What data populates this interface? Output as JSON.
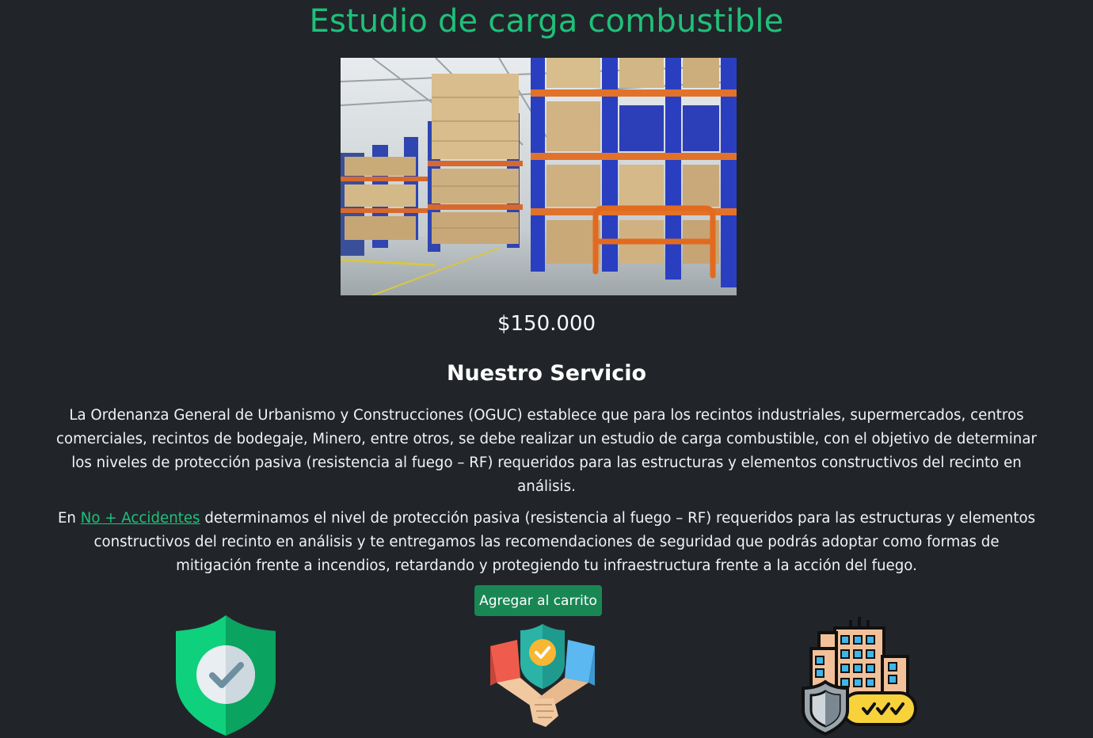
{
  "product": {
    "title": "Estudio de carga combustible",
    "price": "$150.000",
    "image_alt": "warehouse-photo"
  },
  "service": {
    "heading": "Nuestro Servicio",
    "paragraph1": "La Ordenanza General de Urbanismo y Construcciones (OGUC) establece que para los recintos industriales, supermercados, centros comerciales, recintos de bodegaje, Minero, entre otros, se debe realizar un estudio de carga combustible, con el objetivo de determinar los niveles de protección pasiva (resistencia al fuego – RF) requeridos para las estructuras y elementos constructivos del recinto en análisis.",
    "paragraph2_prefix": "En ",
    "paragraph2_link": "No + Accidentes",
    "paragraph2_suffix": " determinamos el nivel de protección pasiva (resistencia al fuego – RF) requeridos para las estructuras y elementos constructivos del recinto en análisis y te entregamos las recomendaciones de seguridad que podrás adoptar como formas de mitigación frente a incendios, retardando y protegiendo tu infraestructura frente a la acción del fuego."
  },
  "actions": {
    "add_to_cart": "Agregar al carrito"
  },
  "icons": [
    "shield-check-icon",
    "handshake-shield-icon",
    "building-security-icon"
  ],
  "colors": {
    "background": "#212529",
    "accent": "#20c07a",
    "button": "#198754"
  }
}
